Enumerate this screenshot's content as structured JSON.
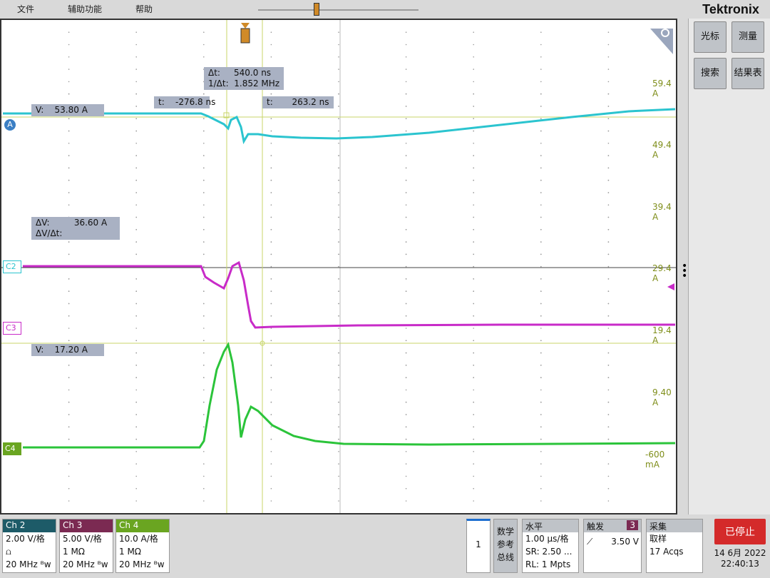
{
  "menu": {
    "file": "文件",
    "utility": "辅助功能",
    "help": "帮助"
  },
  "brand": "Tektronix",
  "side_buttons": {
    "cursor": "光标",
    "measure": "测量",
    "search": "搜索",
    "results": "结果表"
  },
  "readouts": {
    "cursor_delta": "Δt:     540.0 ns\n1/Δt:  1.852 MHz",
    "t1": "t:    -276.8 ns",
    "t2": "t:       263.2 ns",
    "vA": "V:    53.80 A",
    "dv": "ΔV:         36.60 A\nΔV/Δt:",
    "v4": "V:    17.20 A"
  },
  "scale_labels": [
    "59.4 A",
    "49.4 A",
    "39.4 A",
    "29.4 A",
    "19.4 A",
    "9.40 A",
    "-600 mA"
  ],
  "channel_tags": {
    "a": "A",
    "c2": "C2",
    "c3": "C3",
    "c4": "C4"
  },
  "channels": [
    {
      "name": "Ch 2",
      "scale": "2.00 V/格",
      "imp": "⩍",
      "bw": "20 MHz ᴮw",
      "color": "#1d5b68"
    },
    {
      "name": "Ch 3",
      "scale": "5.00 V/格",
      "imp": "1 MΩ",
      "bw": "20 MHz ᴮw",
      "color": "#7b2a52"
    },
    {
      "name": "Ch 4",
      "scale": "10.0 A/格",
      "imp": "1 MΩ",
      "bw": "20 MHz ᴮw",
      "color": "#6aa521"
    }
  ],
  "bottom": {
    "page": "1",
    "ref": "数学\n参考\n总线",
    "horiz": {
      "hd": "水平",
      "l1": "1.00 μs/格",
      "l2": "SR: 2.50 ...",
      "l3": "RL: 1 Mpts"
    },
    "trig": {
      "hd": "触发",
      "ch": "3",
      "level": "3.50 V"
    },
    "acq": {
      "hd": "采集",
      "l1": "取样",
      "l2": "17 Acqs"
    },
    "stop": "已停止",
    "date": "14 6月 2022",
    "time": "22:40:13"
  },
  "colors": {
    "cyan": "#2bc4cf",
    "magenta": "#c82bc8",
    "green": "#2bc43a",
    "gridline": "#c8d66a"
  }
}
